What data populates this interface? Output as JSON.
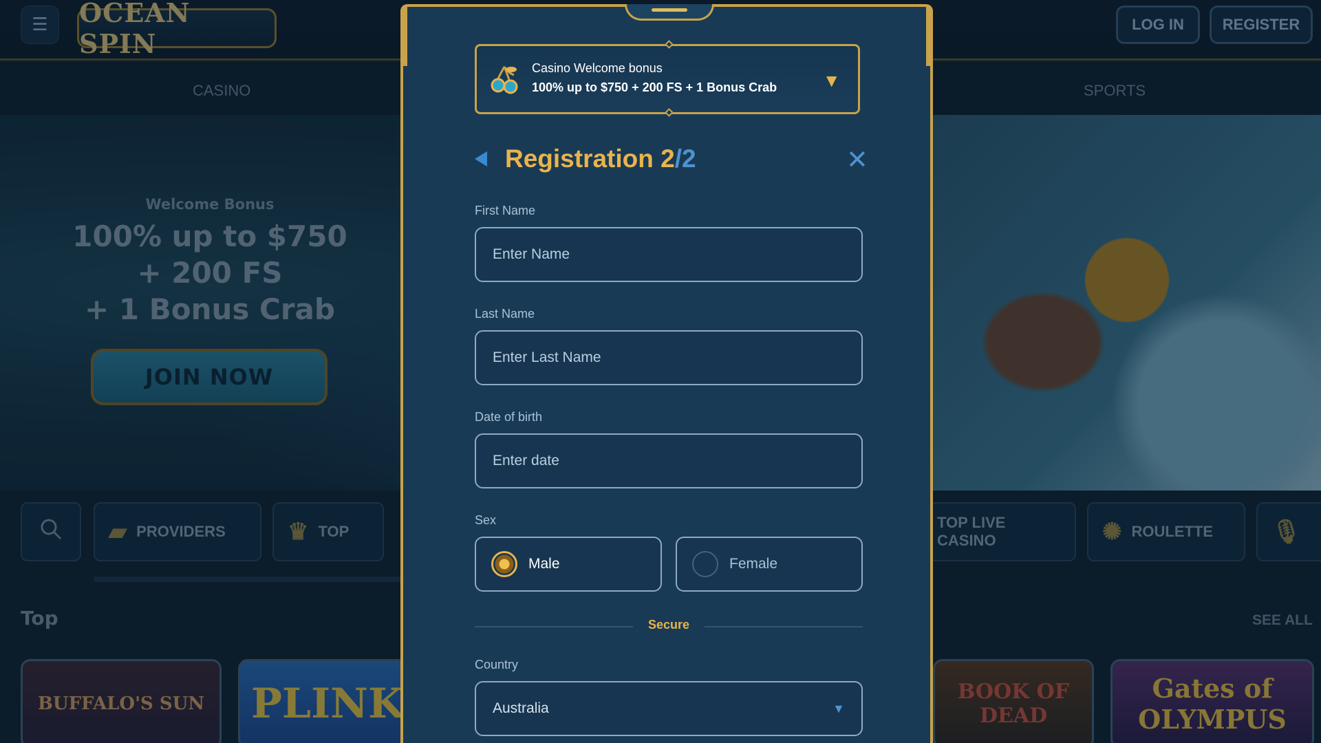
{
  "header": {
    "logo_text": "OCEAN SPIN",
    "login_label": "LOG IN",
    "register_label": "REGISTER",
    "menu_icon": "menu-search-icon"
  },
  "subnav": {
    "casino_label": "CASINO",
    "sports_label": "SPORTS"
  },
  "hero": {
    "eyebrow": "Welcome Bonus",
    "offer_line1": "100% up to $750",
    "offer_line2": "+ 200 FS",
    "offer_line3": "+ 1 Bonus Crab",
    "cta_label": "JOIN NOW"
  },
  "categories": {
    "providers": "PROVIDERS",
    "top": "TOP",
    "top_live_casino": "TOP LIVE CASINO",
    "roulette": "ROULETTE"
  },
  "games_section": {
    "title": "Top",
    "see_all": "SEE ALL",
    "tiles": [
      "BUFFALO'S SUN",
      "PLINK",
      "BOOK OF DEAD",
      "Gates of OLYMPUS"
    ]
  },
  "modal": {
    "bonus": {
      "title": "Casino Welcome bonus",
      "description": "100% up to $750 + 200 FS + 1 Bonus Crab"
    },
    "title": "Registration",
    "step_current": "2",
    "step_total": "/2",
    "fields": {
      "first_name_label": "First Name",
      "first_name_placeholder": "Enter Name",
      "last_name_label": "Last Name",
      "last_name_placeholder": "Enter Last Name",
      "dob_label": "Date of birth",
      "dob_placeholder": "Enter date",
      "sex_label": "Sex",
      "sex_options": [
        "Male",
        "Female"
      ],
      "sex_selected": "Male",
      "secure_label": "Secure",
      "country_label": "Country",
      "country_value": "Australia"
    }
  },
  "colors": {
    "accent_gold": "#e9b44c",
    "accent_blue": "#4f93cf",
    "modal_bg": "#193a55",
    "page_bg": "#0f2537"
  }
}
